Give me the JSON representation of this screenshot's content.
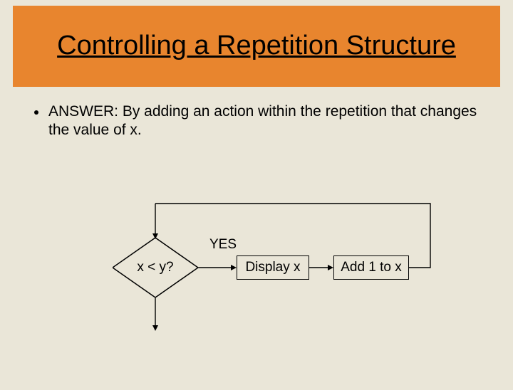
{
  "title": "Controlling a Repetition Structure",
  "bullet": "ANSWER: By adding an action within the repetition that changes the value of x.",
  "flow": {
    "decision": "x < y?",
    "yes_label": "YES",
    "box_display": "Display x",
    "box_add": "Add 1 to x"
  }
}
